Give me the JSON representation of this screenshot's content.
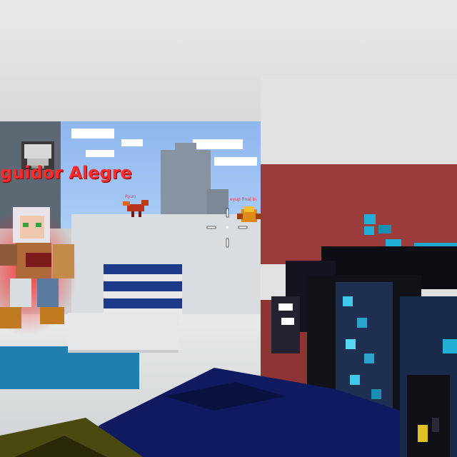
{
  "hud": {
    "player_nickname": "guidor Alegre",
    "enemy_tag_1": "Ryun",
    "enemy_tag_2": "eyup final bi"
  },
  "icons": {
    "armor": "armor-shield-icon",
    "crosshair": "crosshair-icon",
    "weapon": "pixel-gun-weapon"
  },
  "colors": {
    "nickname": "#ff2a2a",
    "player_glow": "#ff2020",
    "sky": "#a9cdf6",
    "pillar_red": "#9b3b3b",
    "weapon_accent": "#22b0d6"
  }
}
